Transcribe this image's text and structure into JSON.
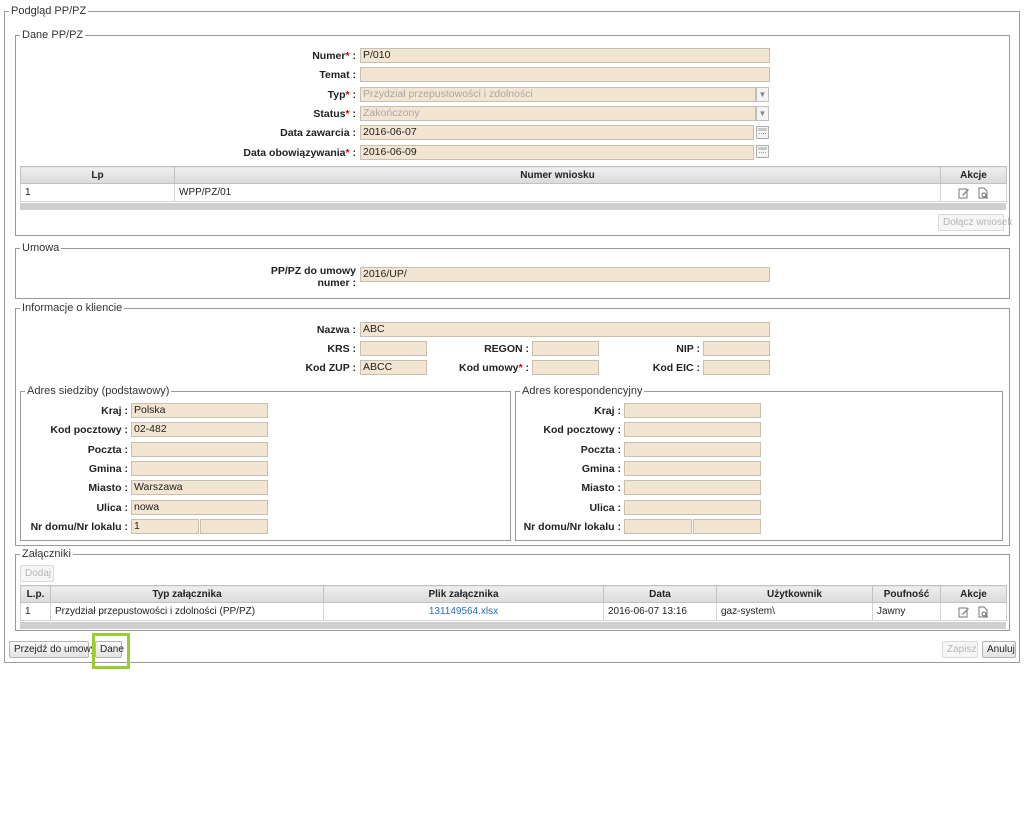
{
  "page": {
    "legend": "Podgląd PP/PZ"
  },
  "dane": {
    "legend": "Dane PP/PZ",
    "fields": {
      "numer": {
        "label": "Numer",
        "value": "P/010"
      },
      "temat": {
        "label": "Temat",
        "value": ""
      },
      "typ": {
        "label": "Typ",
        "value": "Przydział przepustowości i zdolności"
      },
      "status": {
        "label": "Status",
        "value": "Zakończony"
      },
      "data_zawarcia": {
        "label": "Data zawarcia",
        "value": "2016-06-07"
      },
      "data_obowiazywania": {
        "label": "Data obowiązywania",
        "value": "2016-06-09"
      }
    },
    "table": {
      "headers": [
        "Lp",
        "Numer wniosku",
        "Akcje"
      ],
      "rows": [
        {
          "lp": "1",
          "numer": "WPP/PZ/01"
        }
      ]
    },
    "attach_button": "Dołącz wniosek"
  },
  "umowa": {
    "legend": "Umowa",
    "label_line1": "PP/PZ do umowy",
    "label_line2": "numer",
    "value": "2016/UP/"
  },
  "klient": {
    "legend": "Informacje o kliencie",
    "nazwa": {
      "label": "Nazwa",
      "value": "ABC"
    },
    "krs": {
      "label": "KRS",
      "value": ""
    },
    "regon": {
      "label": "REGON",
      "value": ""
    },
    "nip": {
      "label": "NIP",
      "value": ""
    },
    "kod_zup": {
      "label": "Kod ZUP",
      "value": "ABCC"
    },
    "kod_umowy": {
      "label": "Kod umowy",
      "value": ""
    },
    "kod_eic": {
      "label": "Kod EIC",
      "value": ""
    },
    "siedziba": {
      "legend": "Adres siedziby (podstawowy)",
      "kraj": {
        "label": "Kraj",
        "value": "Polska"
      },
      "kod": {
        "label": "Kod pocztowy",
        "value": "02-482"
      },
      "poczta": {
        "label": "Poczta",
        "value": ""
      },
      "gmina": {
        "label": "Gmina",
        "value": ""
      },
      "miasto": {
        "label": "Miasto",
        "value": "Warszawa"
      },
      "ulica": {
        "label": "Ulica",
        "value": "nowa"
      },
      "nr": {
        "label": "Nr domu/Nr lokalu",
        "dom": "1",
        "lokal": ""
      }
    },
    "koresp": {
      "legend": "Adres korespondencyjny",
      "kraj": {
        "label": "Kraj",
        "value": ""
      },
      "kod": {
        "label": "Kod pocztowy",
        "value": ""
      },
      "poczta": {
        "label": "Poczta",
        "value": ""
      },
      "gmina": {
        "label": "Gmina",
        "value": ""
      },
      "miasto": {
        "label": "Miasto",
        "value": ""
      },
      "ulica": {
        "label": "Ulica",
        "value": ""
      },
      "nr": {
        "label": "Nr domu/Nr lokalu",
        "dom": "",
        "lokal": ""
      }
    }
  },
  "zalaczniki": {
    "legend": "Załączniki",
    "add_button": "Dodaj",
    "headers": [
      "L.p.",
      "Typ załącznika",
      "Plik załącznika",
      "Data",
      "Użytkownik",
      "Poufność",
      "Akcje"
    ],
    "rows": [
      {
        "lp": "1",
        "typ": "Przydział przepustowości i zdolności (PP/PZ)",
        "plik": "131149564.xlsx",
        "data": "2016-06-07 13:16",
        "user": "gaz-system\\",
        "poufnosc": "Jawny"
      }
    ]
  },
  "footer": {
    "przejdz": "Przejdź do umowy",
    "dane": "Dane",
    "zapisz": "Zapisz",
    "anuluj": "Anuluj"
  },
  "colors": {
    "input_bg": "#f2e5d1",
    "highlight": "#9acd32",
    "required": "#dd0000",
    "link": "#2a6ebb"
  }
}
